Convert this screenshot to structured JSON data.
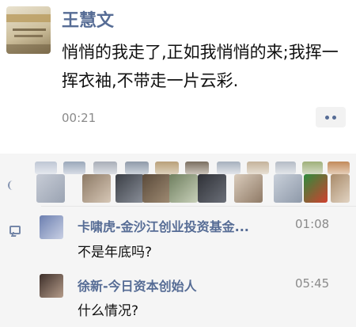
{
  "post": {
    "author": "王慧文",
    "body": "悄悄的我走了,正如我悄悄的来;我挥一挥衣袖,不带走一片云彩.",
    "time": "00:21"
  },
  "comments": [
    {
      "author": "卡啸虎-金沙江创业投资基金...",
      "time": "01:08",
      "text": "不是年底吗?"
    },
    {
      "author": "徐新-今日资本创始人",
      "time": "05:45",
      "text": "什么情况?"
    }
  ],
  "icons": {
    "more": "more-dots-icon",
    "like": "like-icon",
    "comment": "comment-icon"
  },
  "colors": {
    "name_link": "#566c95",
    "timestamp": "#8a8a8a",
    "panel_bg": "#f5f5f5"
  }
}
